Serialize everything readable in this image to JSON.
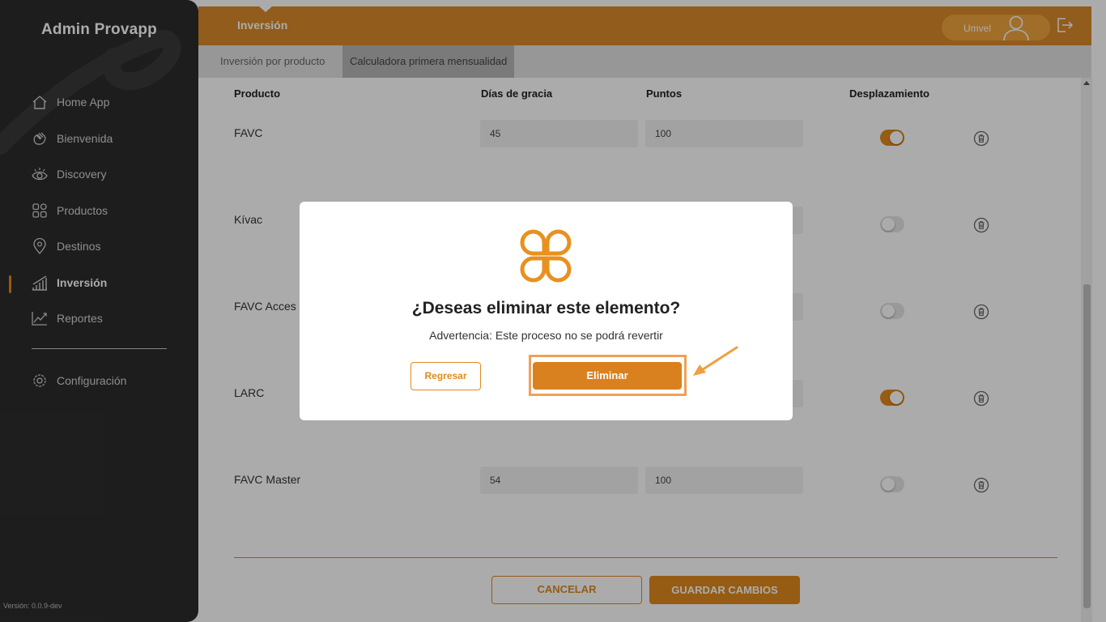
{
  "sidebar": {
    "brand": "Admin Provapp",
    "items": [
      {
        "label": "Home App",
        "icon": "home-icon"
      },
      {
        "label": "Bienvenida",
        "icon": "wave-hand-icon"
      },
      {
        "label": "Discovery",
        "icon": "eye-icon"
      },
      {
        "label": "Productos",
        "icon": "grid-icon"
      },
      {
        "label": "Destinos",
        "icon": "map-pin-icon"
      },
      {
        "label": "Inversión",
        "icon": "bar-chart-icon",
        "active": true
      },
      {
        "label": "Reportes",
        "icon": "line-chart-icon"
      },
      {
        "label": "Configuración",
        "icon": "gear-icon"
      }
    ],
    "version": "Versión: 0.0.9-dev"
  },
  "header": {
    "title": "Inversión",
    "user_name": "Umvel"
  },
  "tabs": [
    "Inversión por producto",
    "Calculadora primera mensualidad"
  ],
  "table": {
    "headers": [
      "Producto",
      "Días de gracia",
      "Puntos",
      "Desplazamiento"
    ],
    "rows": [
      {
        "name": "FAVC",
        "dias": "45",
        "puntos": "100",
        "desplazamiento": true
      },
      {
        "name": "Kívac",
        "dias": "",
        "puntos": "",
        "desplazamiento": false
      },
      {
        "name": "FAVC Acces",
        "dias": "",
        "puntos": "",
        "desplazamiento": false
      },
      {
        "name": "LARC",
        "dias": "",
        "puntos": "",
        "desplazamiento": true
      },
      {
        "name": "FAVC Master",
        "dias": "54",
        "puntos": "100",
        "desplazamiento": false
      }
    ]
  },
  "actions": {
    "cancel": "CANCELAR",
    "save": "GUARDAR CAMBIOS"
  },
  "modal": {
    "title": "¿Deseas eliminar este elemento?",
    "subtitle": "Advertencia: Este proceso no se podrá revertir",
    "back": "Regresar",
    "confirm": "Eliminar"
  },
  "colors": {
    "accent": "#e08a1e",
    "sidebar_bg": "#2c2c2c",
    "topbar": "#d9892a"
  }
}
